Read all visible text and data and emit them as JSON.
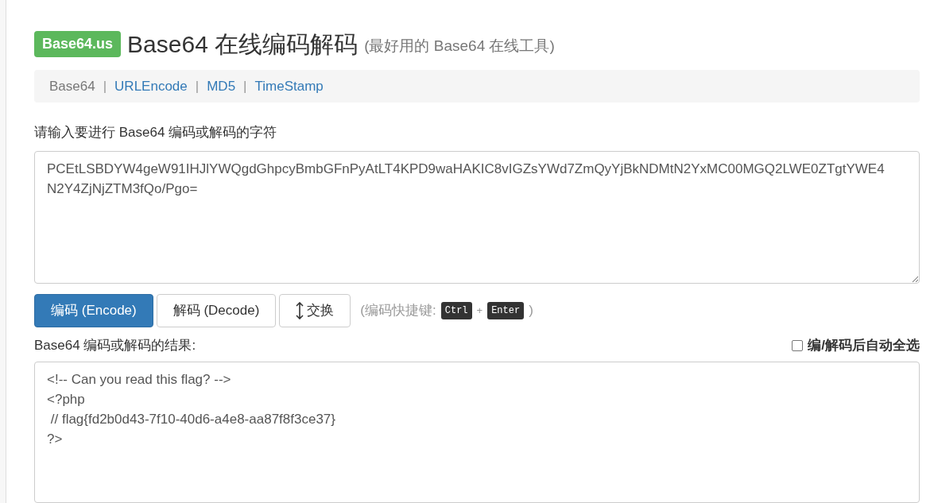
{
  "header": {
    "badge": "Base64.us",
    "title": "Base64 在线编码解码",
    "subtitle": "(最好用的 Base64 在线工具)"
  },
  "nav": [
    {
      "label": "Base64",
      "selected": true
    },
    {
      "label": "URLEncode",
      "selected": false
    },
    {
      "label": "MD5",
      "selected": false
    },
    {
      "label": "TimeStamp",
      "selected": false
    }
  ],
  "separator": "|",
  "input": {
    "label": "请输入要进行 Base64 编码或解码的字符",
    "value": "PCEtLSBDYW4geW91IHJlYWQgdGhpcyBmbGFnPyAtLT4KPD9waHAKIC8vIGZsYWd7ZmQyYjBkNDMtN2YxMC00MGQ2LWE0ZTgtYWE4N2Y4ZjNjZTM3fQo/Pgo="
  },
  "buttons": [
    {
      "label": "编码 (Encode)",
      "kind": "primary"
    },
    {
      "label": "解码 (Decode)",
      "kind": "default"
    },
    {
      "label": "交换",
      "kind": "swap"
    }
  ],
  "shortcut": {
    "prefix": "(编码快捷键:",
    "keys": [
      "Ctrl",
      "Enter"
    ],
    "plus": "+",
    "suffix": ")"
  },
  "output": {
    "label": "Base64 编码或解码的结果:",
    "auto_select": {
      "label": "编/解码后自动全选",
      "checked": false
    },
    "value": "<!-- Can you read this flag? -->\n<?php\n // flag{fd2b0d43-7f10-40d6-a4e8-aa87f8f3ce37}\n?>"
  }
}
